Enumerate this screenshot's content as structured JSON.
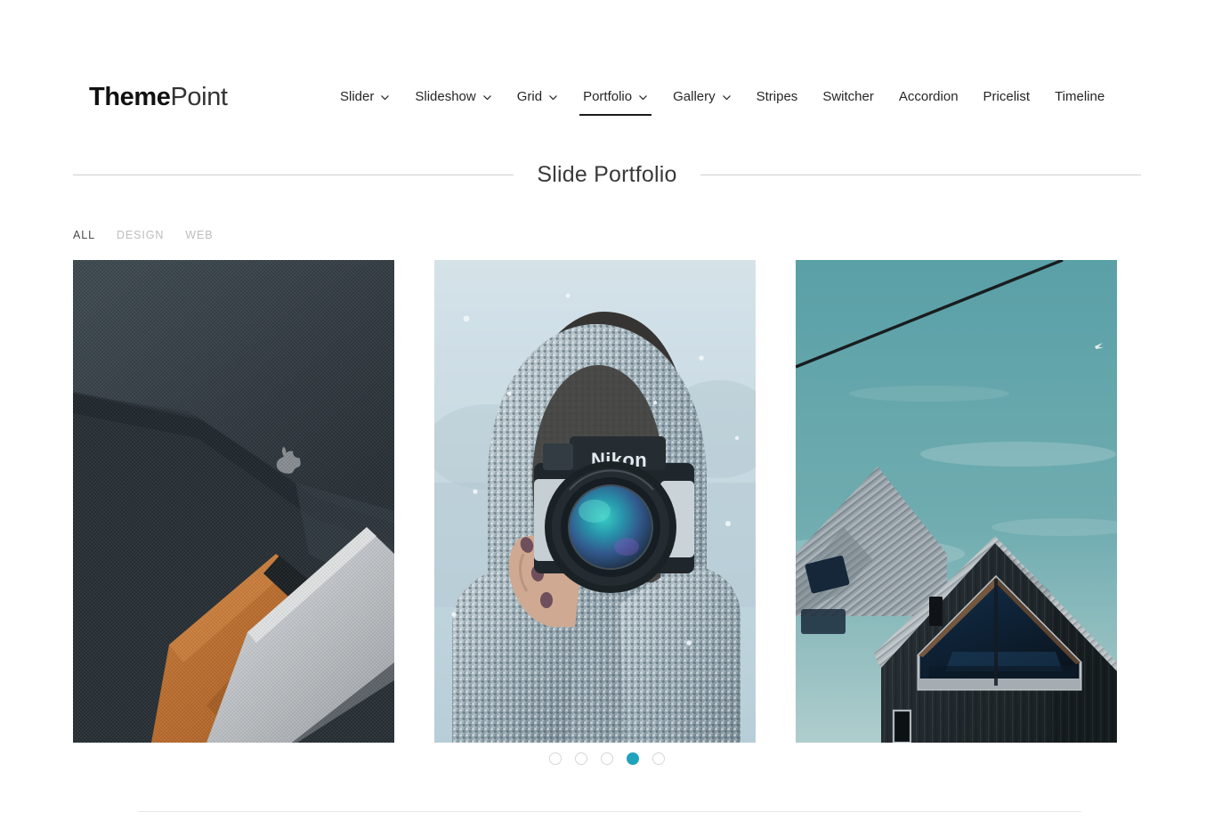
{
  "brand": {
    "name_strong": "Theme",
    "name_light": "Point"
  },
  "nav": {
    "items": [
      {
        "label": "Slider",
        "has_dropdown": true,
        "active": false,
        "icon": "chevron-down-icon"
      },
      {
        "label": "Slideshow",
        "has_dropdown": true,
        "active": false,
        "icon": "chevron-down-icon"
      },
      {
        "label": "Grid",
        "has_dropdown": true,
        "active": false,
        "icon": "chevron-down-icon"
      },
      {
        "label": "Portfolio",
        "has_dropdown": true,
        "active": true,
        "icon": "chevron-down-icon"
      },
      {
        "label": "Gallery",
        "has_dropdown": true,
        "active": false,
        "icon": "chevron-down-icon"
      },
      {
        "label": "Stripes",
        "has_dropdown": false,
        "active": false,
        "icon": ""
      },
      {
        "label": "Switcher",
        "has_dropdown": false,
        "active": false,
        "icon": ""
      },
      {
        "label": "Accordion",
        "has_dropdown": false,
        "active": false,
        "icon": ""
      },
      {
        "label": "Pricelist",
        "has_dropdown": false,
        "active": false,
        "icon": ""
      },
      {
        "label": "Timeline",
        "has_dropdown": false,
        "active": false,
        "icon": ""
      }
    ]
  },
  "section": {
    "title": "Slide Portfolio"
  },
  "filters": {
    "items": [
      {
        "label": "ALL",
        "active": true
      },
      {
        "label": "DESIGN",
        "active": false
      },
      {
        "label": "WEB",
        "active": false
      }
    ]
  },
  "portfolio": {
    "items": [
      {
        "name": "macbook-on-leather-sleeve",
        "description": "Silver laptop resting on a tan leather sleeve atop a dark grey fabric couch"
      },
      {
        "name": "photographer-in-snow",
        "description": "Person in a speckled grey fur hooded coat holding a Nikon camera in falling snow"
      },
      {
        "name": "black-barn-house",
        "description": "Dark timber-clad gabled house with a triangular window against a teal sky with power line"
      }
    ]
  },
  "pagination": {
    "total": 5,
    "active_index": 4,
    "dots": [
      {
        "label": "1",
        "active": false
      },
      {
        "label": "2",
        "active": false
      },
      {
        "label": "3",
        "active": false
      },
      {
        "label": "4",
        "active": true
      },
      {
        "label": "5",
        "active": false
      }
    ]
  },
  "colors": {
    "accent": "#21a3bd",
    "text": "#262626",
    "muted": "#bcbcbc",
    "rule": "#cfcfcf",
    "divider": "#e6e6e6"
  }
}
